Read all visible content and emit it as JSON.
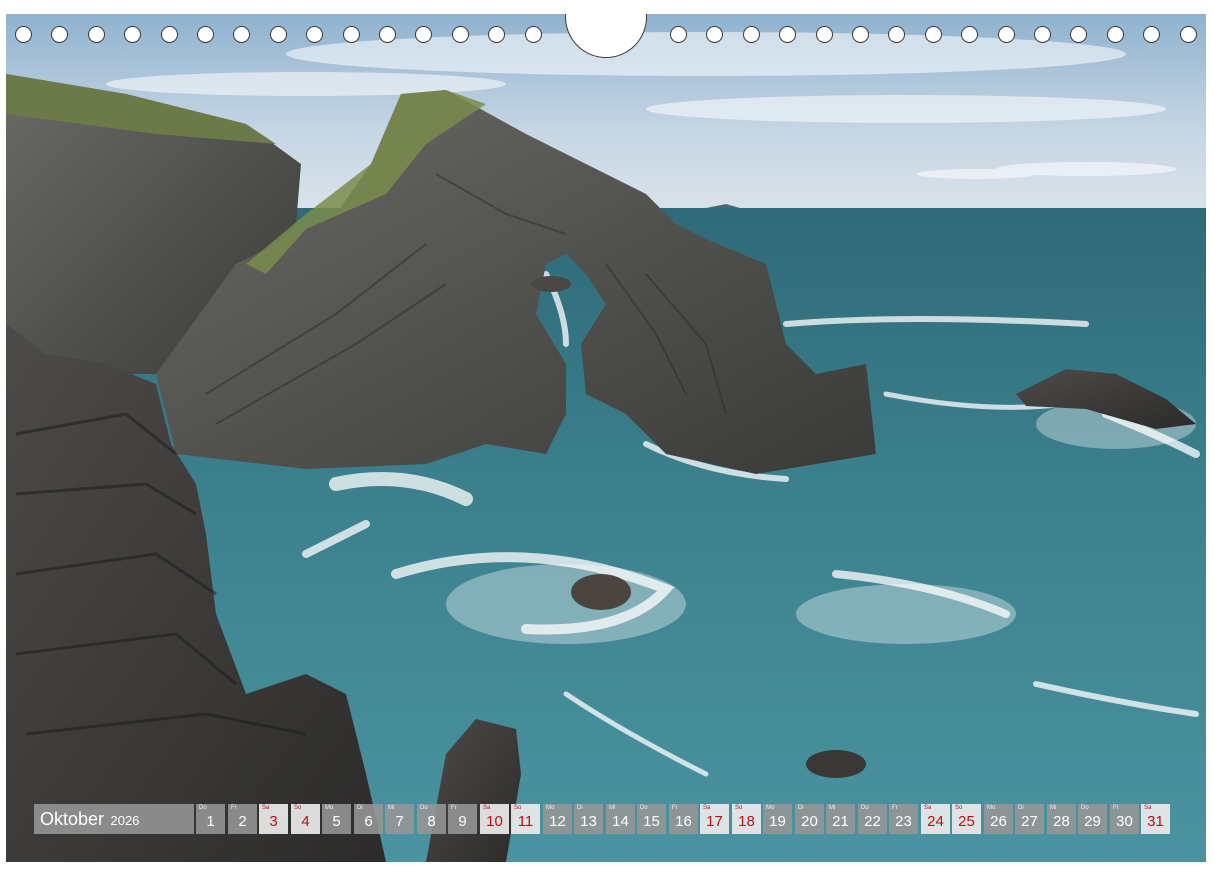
{
  "calendar": {
    "month": "Oktober",
    "year": "2026",
    "days": [
      {
        "wd": "Do",
        "num": "1",
        "weekend": false
      },
      {
        "wd": "Fr",
        "num": "2",
        "weekend": false
      },
      {
        "wd": "Sa",
        "num": "3",
        "weekend": true
      },
      {
        "wd": "So",
        "num": "4",
        "weekend": true
      },
      {
        "wd": "Mo",
        "num": "5",
        "weekend": false
      },
      {
        "wd": "Di",
        "num": "6",
        "weekend": false
      },
      {
        "wd": "Mi",
        "num": "7",
        "weekend": false
      },
      {
        "wd": "Do",
        "num": "8",
        "weekend": false
      },
      {
        "wd": "Fr",
        "num": "9",
        "weekend": false
      },
      {
        "wd": "Sa",
        "num": "10",
        "weekend": true
      },
      {
        "wd": "So",
        "num": "11",
        "weekend": true
      },
      {
        "wd": "Mo",
        "num": "12",
        "weekend": false
      },
      {
        "wd": "Di",
        "num": "13",
        "weekend": false
      },
      {
        "wd": "Mi",
        "num": "14",
        "weekend": false
      },
      {
        "wd": "Do",
        "num": "15",
        "weekend": false
      },
      {
        "wd": "Fr",
        "num": "16",
        "weekend": false
      },
      {
        "wd": "Sa",
        "num": "17",
        "weekend": true
      },
      {
        "wd": "So",
        "num": "18",
        "weekend": true
      },
      {
        "wd": "Mo",
        "num": "19",
        "weekend": false
      },
      {
        "wd": "Di",
        "num": "20",
        "weekend": false
      },
      {
        "wd": "Mi",
        "num": "21",
        "weekend": false
      },
      {
        "wd": "Do",
        "num": "22",
        "weekend": false
      },
      {
        "wd": "Fr",
        "num": "23",
        "weekend": false
      },
      {
        "wd": "Sa",
        "num": "24",
        "weekend": true
      },
      {
        "wd": "So",
        "num": "25",
        "weekend": true
      },
      {
        "wd": "Mo",
        "num": "26",
        "weekend": false
      },
      {
        "wd": "Di",
        "num": "27",
        "weekend": false
      },
      {
        "wd": "Mi",
        "num": "28",
        "weekend": false
      },
      {
        "wd": "Do",
        "num": "29",
        "weekend": false
      },
      {
        "wd": "Fr",
        "num": "30",
        "weekend": false
      },
      {
        "wd": "Sa",
        "num": "31",
        "weekend": true
      }
    ]
  },
  "colors": {
    "weekend_text": "#b8101a",
    "cell_bg": "#969696",
    "sea": "#3f7f8c",
    "sky": "#b9cde0"
  },
  "binding": {
    "hole_count_left": 15,
    "hole_count_right": 15
  }
}
